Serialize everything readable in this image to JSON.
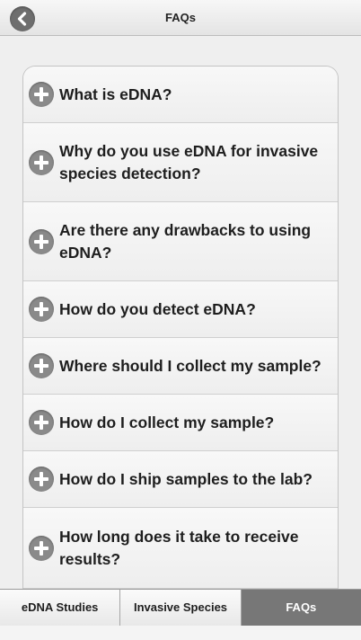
{
  "header": {
    "title": "FAQs"
  },
  "faq": {
    "items": [
      {
        "question": "What is eDNA?"
      },
      {
        "question": "Why do you use eDNA for invasive species detection?"
      },
      {
        "question": "Are there any drawbacks to using eDNA?"
      },
      {
        "question": "How do you detect eDNA?"
      },
      {
        "question": "Where should I collect my sample?"
      },
      {
        "question": "How do I collect my sample?"
      },
      {
        "question": "How do I ship samples to the lab?"
      },
      {
        "question": "How long does it take to receive results?"
      }
    ]
  },
  "tabs": [
    {
      "label": "eDNA Studies",
      "active": false
    },
    {
      "label": "Invasive Species",
      "active": false
    },
    {
      "label": "FAQs",
      "active": true
    }
  ],
  "colors": {
    "active_tab": "#777777",
    "expand_icon": "#8a8a8a",
    "back_button": "#6e6e6e"
  },
  "icons": {
    "back": "chevron-left-icon",
    "expand": "plus-icon"
  }
}
